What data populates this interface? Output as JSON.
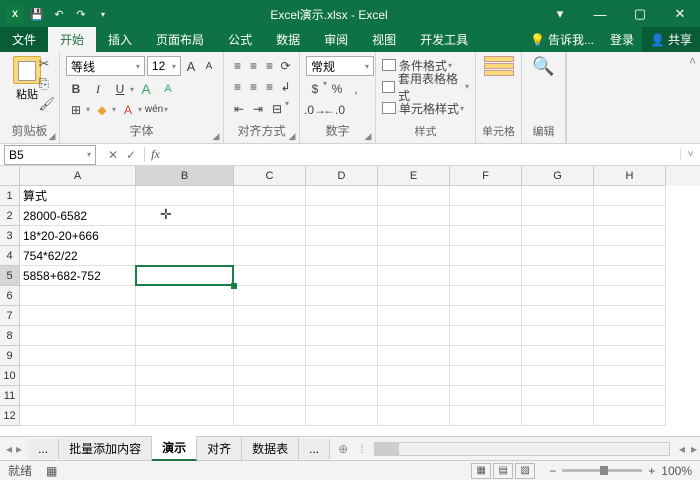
{
  "titlebar": {
    "title": "Excel演示.xlsx - Excel"
  },
  "win": {
    "min": "—",
    "max": "▢",
    "close": "✕",
    "ribmin": "▾"
  },
  "tabs": {
    "file": "文件",
    "home": "开始",
    "insert": "插入",
    "pagelayout": "页面布局",
    "formulas": "公式",
    "data": "数据",
    "review": "审阅",
    "view": "视图",
    "dev": "开发工具",
    "tell": "告诉我...",
    "login": "登录",
    "share": "共享"
  },
  "ribbon": {
    "clipboard": {
      "paste": "粘贴",
      "label": "剪贴板"
    },
    "font": {
      "name": "等线",
      "size": "12",
      "label": "字体",
      "b": "B",
      "i": "I",
      "u": "U",
      "bigA": "A",
      "smallA": "A",
      "wen": "wén"
    },
    "align": {
      "label": "对齐方式"
    },
    "number": {
      "format": "常规",
      "label": "数字"
    },
    "styles": {
      "cond": "条件格式",
      "tbl": "套用表格格式",
      "cell": "单元格样式",
      "label": "样式"
    },
    "cells": {
      "label": "单元格"
    },
    "edit": {
      "label": "编辑"
    }
  },
  "namebox": "B5",
  "columns": [
    "A",
    "B",
    "C",
    "D",
    "E",
    "F",
    "G",
    "H"
  ],
  "rows": [
    "1",
    "2",
    "3",
    "4",
    "5",
    "6",
    "7",
    "8",
    "9",
    "10",
    "11",
    "12"
  ],
  "cells": {
    "A1": "算式",
    "A2": "28000-6582",
    "A3": "18*20-20+666",
    "A4": "754*62/22",
    "A5": "5858+682-752"
  },
  "sheets": {
    "dots": "...",
    "bulk": "批量添加内容",
    "demo": "演示",
    "align": "对齐",
    "data": "数据表",
    "more": "..."
  },
  "status": {
    "ready": "就绪",
    "zoom": "100%"
  }
}
